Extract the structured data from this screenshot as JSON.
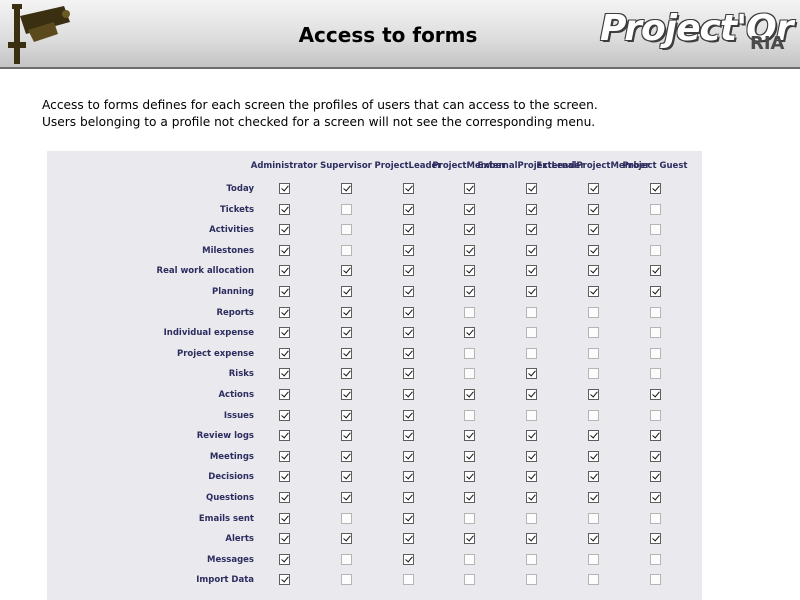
{
  "header": {
    "title": "Access to forms",
    "logo_main": "Project'Or",
    "logo_sub": "RIA"
  },
  "intro": {
    "line1": "Access to forms defines for each screen the profiles of users that can access to the screen.",
    "line2": "Users belonging to a profile not checked for a screen will not see the corresponding menu."
  },
  "profiles": [
    [
      "Administrator"
    ],
    [
      "Supervisor"
    ],
    [
      "Project",
      "Leader"
    ],
    [
      "Project",
      "Member"
    ],
    [
      "External",
      "Project",
      "Leader"
    ],
    [
      "External",
      "Project",
      "Member"
    ],
    [
      "Project Guest"
    ]
  ],
  "rows": [
    {
      "label": "Today",
      "access": [
        1,
        1,
        1,
        1,
        1,
        1,
        1
      ]
    },
    {
      "label": "Tickets",
      "access": [
        1,
        0,
        1,
        1,
        1,
        1,
        0
      ]
    },
    {
      "label": "Activities",
      "access": [
        1,
        0,
        1,
        1,
        1,
        1,
        0
      ]
    },
    {
      "label": "Milestones",
      "access": [
        1,
        0,
        1,
        1,
        1,
        1,
        0
      ]
    },
    {
      "label": "Real work allocation",
      "access": [
        1,
        1,
        1,
        1,
        1,
        1,
        1
      ]
    },
    {
      "label": "Planning",
      "access": [
        1,
        1,
        1,
        1,
        1,
        1,
        1
      ]
    },
    {
      "label": "Reports",
      "access": [
        1,
        1,
        1,
        0,
        0,
        0,
        0
      ]
    },
    {
      "label": "Individual expense",
      "access": [
        1,
        1,
        1,
        1,
        0,
        0,
        0
      ]
    },
    {
      "label": "Project expense",
      "access": [
        1,
        1,
        1,
        0,
        0,
        0,
        0
      ]
    },
    {
      "label": "Risks",
      "access": [
        1,
        1,
        1,
        0,
        1,
        0,
        0
      ]
    },
    {
      "label": "Actions",
      "access": [
        1,
        1,
        1,
        1,
        1,
        1,
        1
      ]
    },
    {
      "label": "Issues",
      "access": [
        1,
        1,
        1,
        0,
        0,
        0,
        0
      ]
    },
    {
      "label": "Review logs",
      "access": [
        1,
        1,
        1,
        1,
        1,
        1,
        1
      ]
    },
    {
      "label": "Meetings",
      "access": [
        1,
        1,
        1,
        1,
        1,
        1,
        1
      ]
    },
    {
      "label": "Decisions",
      "access": [
        1,
        1,
        1,
        1,
        1,
        1,
        1
      ]
    },
    {
      "label": "Questions",
      "access": [
        1,
        1,
        1,
        1,
        1,
        1,
        1
      ]
    },
    {
      "label": "Emails sent",
      "access": [
        1,
        0,
        1,
        0,
        0,
        0,
        0
      ]
    },
    {
      "label": "Alerts",
      "access": [
        1,
        1,
        1,
        1,
        1,
        1,
        1
      ]
    },
    {
      "label": "Messages",
      "access": [
        1,
        0,
        1,
        0,
        0,
        0,
        0
      ]
    },
    {
      "label": "Import Data",
      "access": [
        1,
        0,
        0,
        0,
        0,
        0,
        0
      ]
    }
  ],
  "colors": {
    "label_text": "#2d2d5f",
    "panel_bg": "#e9e9ee"
  },
  "icons": {
    "header_icon": "security-camera-icon",
    "logo": "projector-ria-logo"
  }
}
